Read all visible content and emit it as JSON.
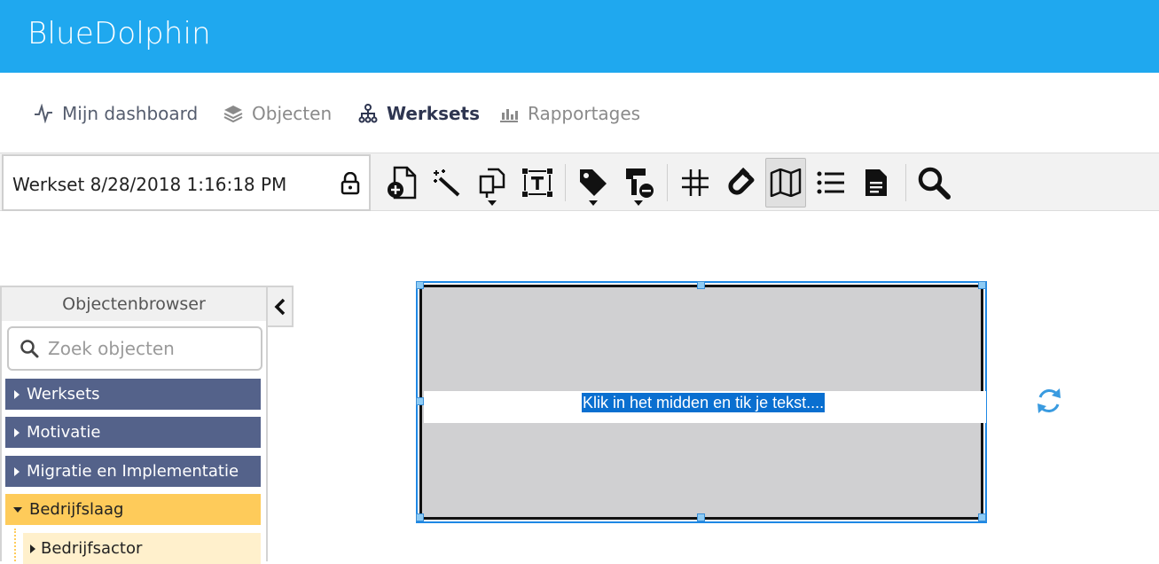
{
  "app": {
    "title": "BlueDolphin",
    "brand_color": "#1fa8ef"
  },
  "nav": {
    "items": [
      {
        "label": "Mijn dashboard",
        "icon": "pulse-icon",
        "state": "normal"
      },
      {
        "label": "Objecten",
        "icon": "layers-icon",
        "state": "muted"
      },
      {
        "label": "Werksets",
        "icon": "hierarchy-icon",
        "state": "active"
      },
      {
        "label": "Rapportages",
        "icon": "bar-chart-icon",
        "state": "muted"
      }
    ]
  },
  "toolbar": {
    "workset_name": "Werkset 8/28/2018 1:16:18 PM",
    "tools": [
      "add-document-icon",
      "magic-wand-icon",
      "copy-shapes-icon",
      "text-frame-icon",
      "tag-icon",
      "format-paint-icon",
      "grid-icon",
      "magnet-icon",
      "map-icon",
      "list-icon",
      "document-icon",
      "search-icon"
    ]
  },
  "object_browser": {
    "title": "Objectenbrowser",
    "search_placeholder": "Zoek objecten",
    "items": [
      {
        "label": "Werksets",
        "style": "dark",
        "expanded": false
      },
      {
        "label": "Motivatie",
        "style": "dark",
        "expanded": false
      },
      {
        "label": "Migratie en Implementatie",
        "style": "dark",
        "expanded": false
      },
      {
        "label": "Bedrijfslaag",
        "style": "open",
        "expanded": true
      },
      {
        "label": "Bedrijfsactor",
        "style": "child",
        "expanded": false
      }
    ]
  },
  "canvas": {
    "shape_text": "Klik in het midden en tik je tekst....",
    "selection_color": "#1e88e5"
  }
}
